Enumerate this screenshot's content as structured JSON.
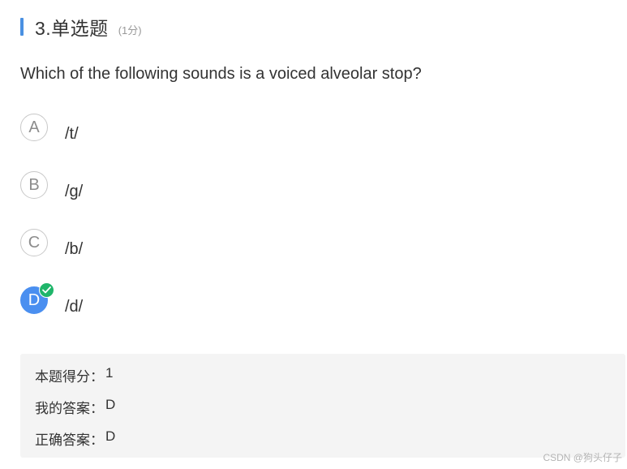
{
  "header": {
    "title": "3.单选题",
    "score": "(1分)",
    "accent_color": "#4a90e2"
  },
  "question": {
    "text": "Which of the following sounds is a voiced alveolar stop?"
  },
  "options": [
    {
      "letter": "A",
      "text": "/t/",
      "selected": false
    },
    {
      "letter": "B",
      "text": "/g/",
      "selected": false
    },
    {
      "letter": "C",
      "text": "/b/",
      "selected": false
    },
    {
      "letter": "D",
      "text": "/d/",
      "selected": true,
      "correct_icon": "check-icon"
    }
  ],
  "result": {
    "score_label": "本题得分：",
    "score_value": "1",
    "my_answer_label": "我的答案：",
    "my_answer_value": "D",
    "correct_answer_label": "正确答案：",
    "correct_answer_value": "D"
  },
  "watermark": "CSDN @狗头仔子",
  "colors": {
    "selected": "#4a8ff0",
    "correct_badge": "#1fb56a",
    "result_bg": "#f4f4f4"
  }
}
